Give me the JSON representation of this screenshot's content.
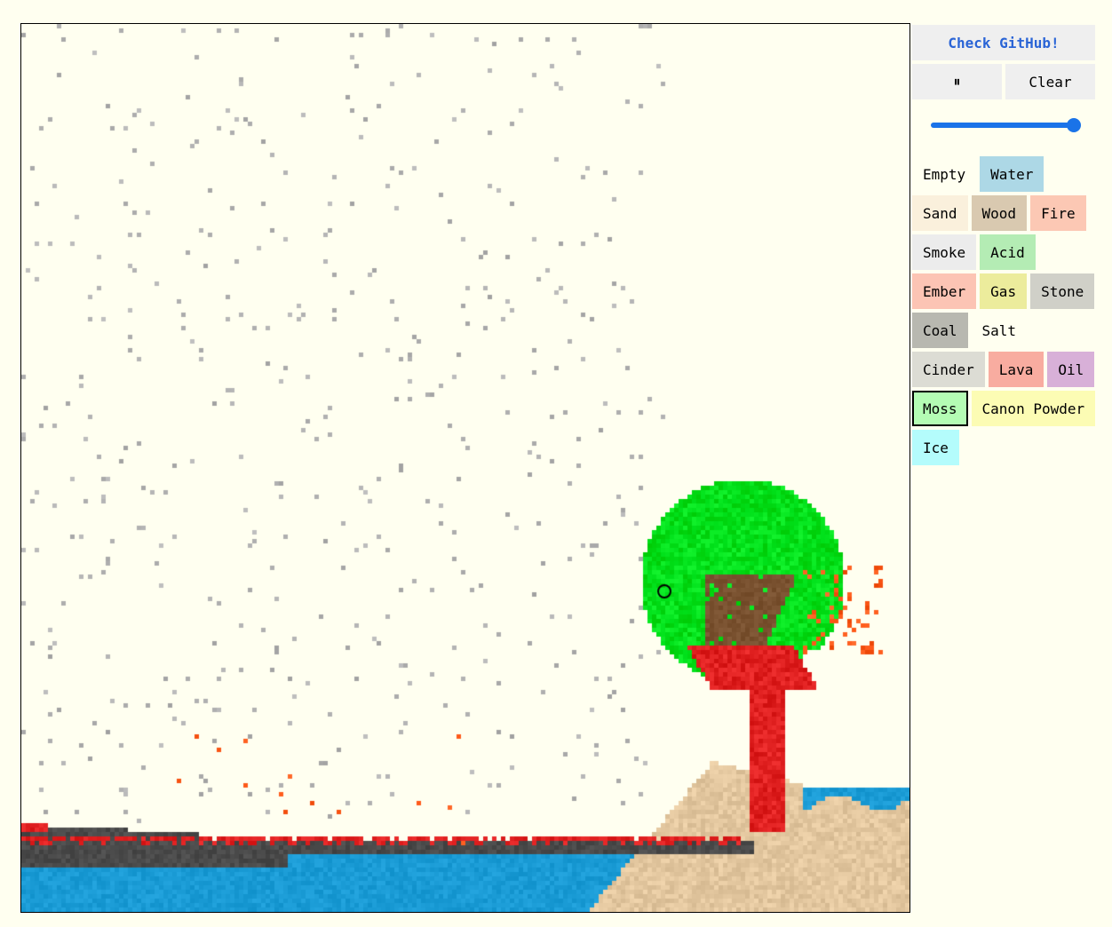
{
  "controls": {
    "github_label": "Check GitHub!",
    "pause_label": "⏸",
    "clear_label": "Clear",
    "speed": 1.0
  },
  "colors": {
    "accent": "#1a73e8",
    "link": "#2a64d6",
    "background": "#fffff0",
    "water": "#1a9bd5",
    "sand": "#e3c79f",
    "moss": "#00e01a",
    "lava": "#e02020",
    "wood": "#7a5230",
    "cinder": "#4a4a4a",
    "smoke": "#b0b0b0",
    "ember": "#ff5a1a"
  },
  "elements": [
    {
      "label": "Empty",
      "color": "#fffff0",
      "selected": false
    },
    {
      "label": "Water",
      "color": "#add8e6",
      "selected": false
    },
    {
      "label": "Sand",
      "color": "#faf0dc",
      "selected": false
    },
    {
      "label": "Wood",
      "color": "#d9c9b0",
      "selected": false
    },
    {
      "label": "Fire",
      "color": "#fcc8b4",
      "selected": false
    },
    {
      "label": "Smoke",
      "color": "#ececec",
      "selected": false
    },
    {
      "label": "Acid",
      "color": "#b4ecb4",
      "selected": false
    },
    {
      "label": "Ember",
      "color": "#fcc4b4",
      "selected": false
    },
    {
      "label": "Gas",
      "color": "#ecec9c",
      "selected": false
    },
    {
      "label": "Stone",
      "color": "#d0d0c8",
      "selected": false
    },
    {
      "label": "Coal",
      "color": "#b8b8b0",
      "selected": false
    },
    {
      "label": "Salt",
      "color": "#fffff0",
      "selected": false
    },
    {
      "label": "Cinder",
      "color": "#dcdcd4",
      "selected": false
    },
    {
      "label": "Lava",
      "color": "#f8aca0",
      "selected": false
    },
    {
      "label": "Oil",
      "color": "#d8b0d8",
      "selected": false
    },
    {
      "label": "Moss",
      "color": "#b4fcb4",
      "selected": true
    },
    {
      "label": "Canon Powder",
      "color": "#fcfcb4",
      "selected": false
    },
    {
      "label": "Ice",
      "color": "#b4fcfc",
      "selected": false
    }
  ]
}
